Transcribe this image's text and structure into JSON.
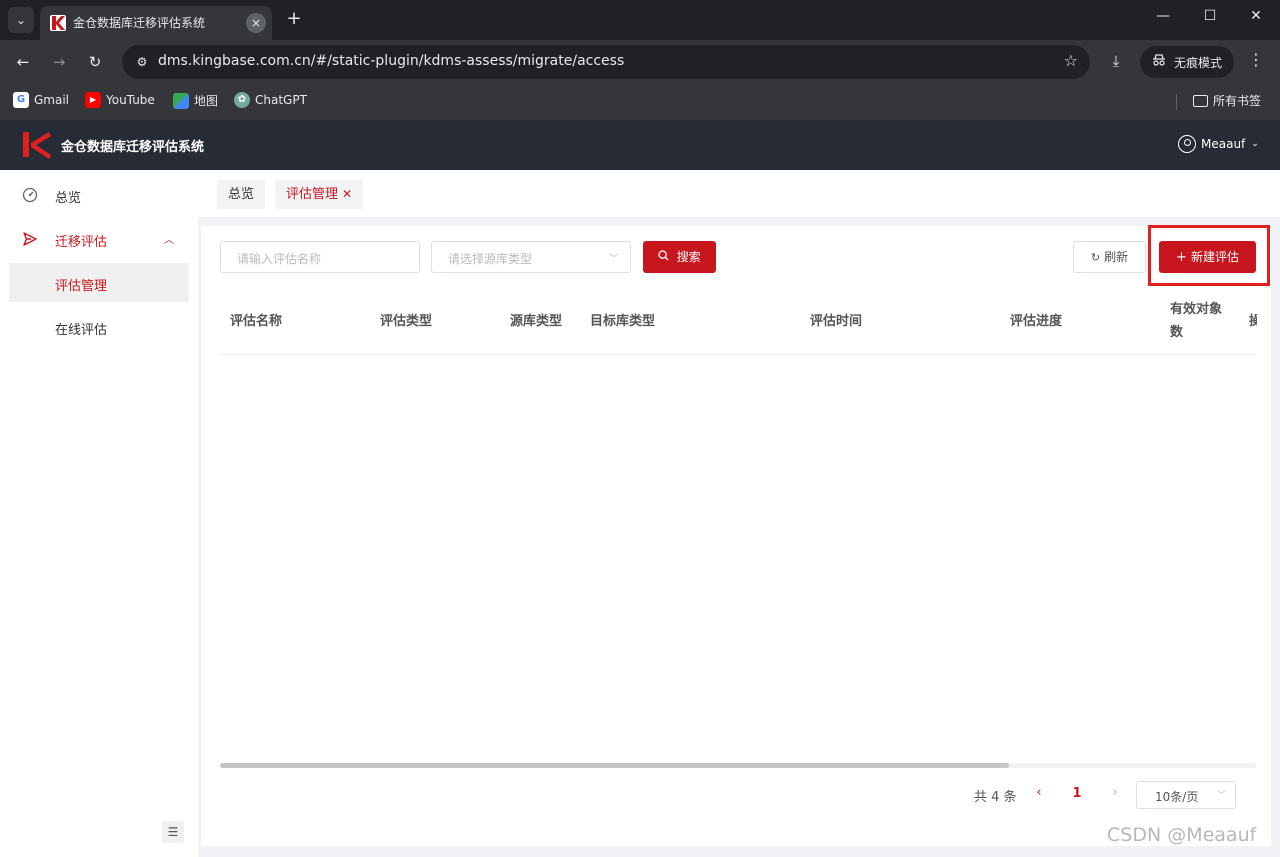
{
  "browser": {
    "tab_title": "金仓数据库迁移评估系统",
    "tab_close": "×",
    "new_tab": "+",
    "url": "dms.kingbase.com.cn/#/static-plugin/kdms-assess/migrate/access",
    "incognito_label": "无痕模式",
    "bookmarks": [
      {
        "label": "Gmail",
        "icon": "google-icon"
      },
      {
        "label": "YouTube",
        "icon": "youtube-icon"
      },
      {
        "label": "地图",
        "icon": "maps-icon"
      },
      {
        "label": "ChatGPT",
        "icon": "chatgpt-icon"
      }
    ],
    "all_bookmarks": "所有书签"
  },
  "app": {
    "title": "金仓数据库迁移评估系统",
    "user": "Meaauf",
    "brand_color": "#c8161e",
    "header_bg": "#262b36"
  },
  "sidebar": {
    "items": [
      {
        "label": "总览",
        "icon": "dashboard-icon"
      },
      {
        "label": "迁移评估",
        "icon": "send-icon"
      }
    ],
    "sub_items": [
      {
        "label": "评估管理",
        "selected": true
      },
      {
        "label": "在线评估",
        "selected": false
      }
    ]
  },
  "tags": [
    {
      "label": "总览"
    },
    {
      "label": "评估管理"
    }
  ],
  "toolbar": {
    "name_placeholder": "请输入评估名称",
    "source_placeholder": "请选择源库类型",
    "search_label": "搜索",
    "refresh_label": "刷新",
    "new_label": "新建评估"
  },
  "table": {
    "headers": [
      "评估名称",
      "评估类型",
      "源库类型",
      "目标库类型",
      "评估时间",
      "评估进度",
      "有效对象数",
      "操"
    ],
    "rows": []
  },
  "pagination": {
    "total_text": "共 4 条",
    "current_page": "1",
    "page_size": "10条/页"
  },
  "watermark": "CSDN @Meaauf"
}
